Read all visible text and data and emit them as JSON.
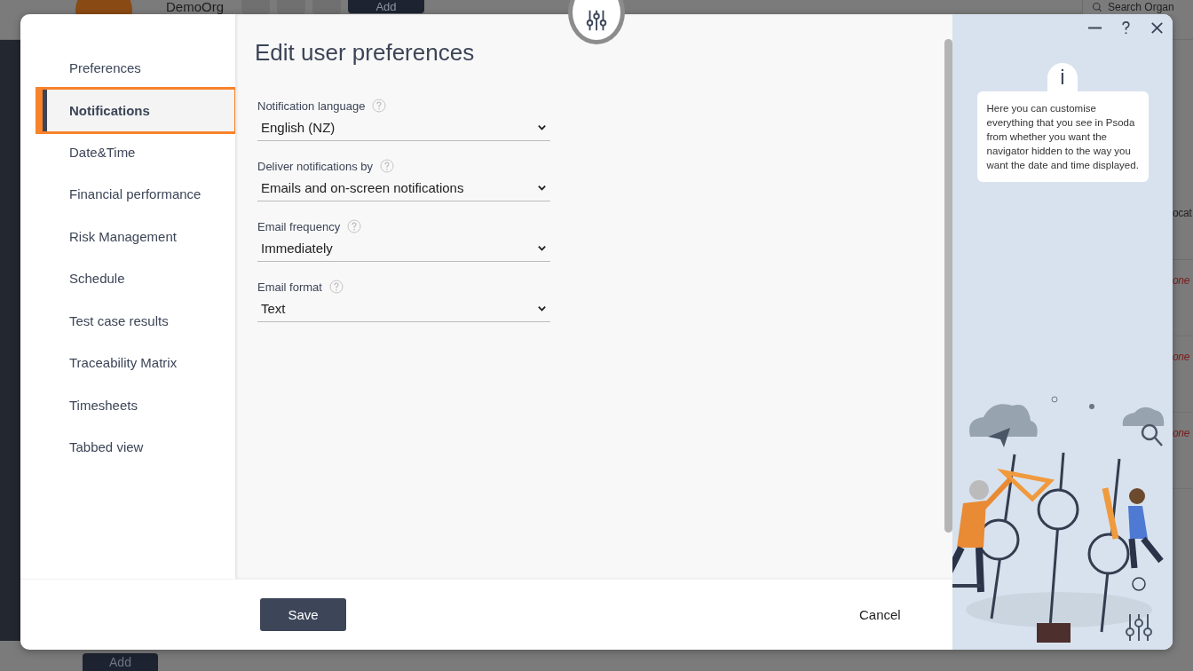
{
  "background": {
    "org_name": "DemoOrg",
    "add_button": "Add",
    "search_placeholder": "Search Organ",
    "column_header": "ocat",
    "cells": [
      "one",
      "one",
      "one"
    ],
    "bottom_add_button": "Add"
  },
  "dialog": {
    "title": "Edit user preferences",
    "nav": [
      {
        "label": "Preferences",
        "selected": false
      },
      {
        "label": "Notifications",
        "selected": true
      },
      {
        "label": "Date&Time",
        "selected": false
      },
      {
        "label": "Financial performance",
        "selected": false
      },
      {
        "label": "Risk Management",
        "selected": false
      },
      {
        "label": "Schedule",
        "selected": false
      },
      {
        "label": "Test case results",
        "selected": false
      },
      {
        "label": "Traceability Matrix",
        "selected": false
      },
      {
        "label": "Timesheets",
        "selected": false
      },
      {
        "label": "Tabbed view",
        "selected": false
      }
    ],
    "fields": [
      {
        "label": "Notification language",
        "value": "English (NZ)"
      },
      {
        "label": "Deliver notifications by",
        "value": "Emails and on-screen notifications"
      },
      {
        "label": "Email frequency",
        "value": "Immediately"
      },
      {
        "label": "Email format",
        "value": "Text"
      }
    ],
    "save_button": "Save",
    "cancel_button": "Cancel",
    "info": {
      "mark": "i",
      "text": "Here you can customise everything that you see in Psoda from whether you want the navigator hidden to the way you want the date and time displayed."
    }
  }
}
